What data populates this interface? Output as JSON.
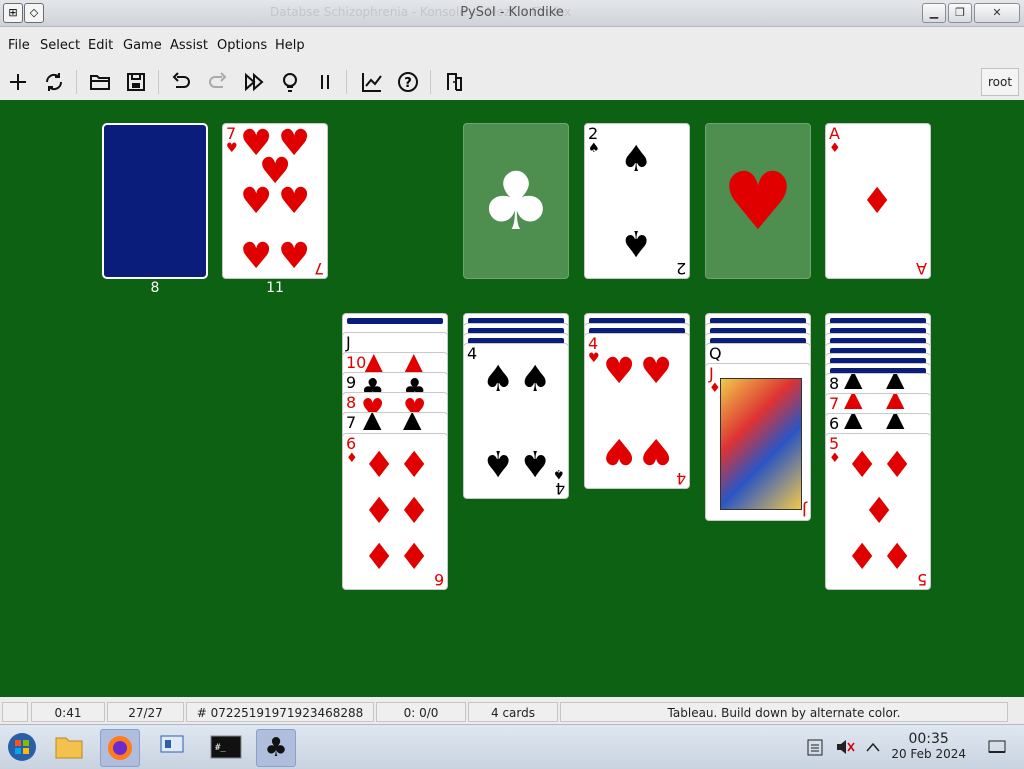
{
  "window": {
    "title": "PySol - Klondike",
    "background_title": "Databse Schizophrenia - Konsole — Mozilla Firefox",
    "controls": [
      "minimize",
      "maximize",
      "close"
    ]
  },
  "menu": [
    "File",
    "Select",
    "Edit",
    "Game",
    "Assist",
    "Options",
    "Help"
  ],
  "toolbar": {
    "icons": [
      "new-game",
      "restart",
      "open",
      "save",
      "undo",
      "redo",
      "autodrop",
      "hint",
      "pause",
      "statistics",
      "help",
      "quit"
    ],
    "user": "root"
  },
  "piles": {
    "stock_count": "8",
    "waste_count": "11",
    "waste_card": {
      "rank": "7",
      "suit": "♥"
    },
    "foundations": [
      {
        "suit": "♣",
        "card": null
      },
      {
        "suit": "♠",
        "card": "2"
      },
      {
        "suit": "♥",
        "card": null
      },
      {
        "suit": "♦",
        "card": "A"
      }
    ]
  },
  "tableau": [
    {
      "faceup": [
        "J",
        "10",
        "9",
        "8",
        "7",
        "6"
      ],
      "bottom": {
        "rank": "6",
        "suit": "♦"
      }
    },
    {
      "faceup": [
        "4"
      ],
      "bottom": {
        "rank": "4",
        "suit": "♠"
      }
    },
    {
      "faceup": [
        "4"
      ],
      "bottom": {
        "rank": "4",
        "suit": "♥"
      }
    },
    {
      "faceup": [
        "Q",
        "J"
      ],
      "bottom": {
        "rank": "J",
        "suit": "♦"
      }
    },
    {
      "faceup": [
        "8",
        "7",
        "6",
        "5"
      ],
      "bottom": {
        "rank": "5",
        "suit": "♦"
      }
    }
  ],
  "status": {
    "time": "0:41",
    "cards_left": "27/27",
    "game_number": "# 07225191971923468288",
    "moves": "0: 0/0",
    "cards": "4 cards",
    "hint": "Tableau. Build down by alternate color."
  },
  "taskbar": {
    "time": "00:35",
    "date": "20 Feb 2024"
  },
  "colors": {
    "felt": "#0c6212",
    "card_back": "#0b1d7a",
    "red_suit": "#e00000"
  }
}
